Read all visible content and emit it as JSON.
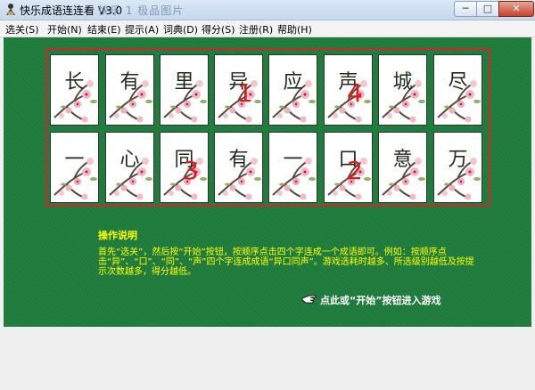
{
  "window": {
    "title": "快乐成语连连看 V3.0",
    "title_ghost": "快乐 1 极品图片",
    "minimize": "─",
    "maximize": "□",
    "close": "✕"
  },
  "menu": [
    {
      "label": "选关(S)"
    },
    {
      "label": "开始(N)"
    },
    {
      "label": "结束(E)"
    },
    {
      "label": "提示(A)"
    },
    {
      "label": "词典(D)"
    },
    {
      "label": "得分(S)"
    },
    {
      "label": "注册(R)"
    },
    {
      "label": "帮助(H)"
    }
  ],
  "cards_row1": [
    {
      "char": "长",
      "num": ""
    },
    {
      "char": "有",
      "num": ""
    },
    {
      "char": "里",
      "num": ""
    },
    {
      "char": "异",
      "num": "1"
    },
    {
      "char": "应",
      "num": ""
    },
    {
      "char": "声",
      "num": "4"
    },
    {
      "char": "城",
      "num": ""
    },
    {
      "char": "尽",
      "num": ""
    }
  ],
  "cards_row2": [
    {
      "char": "一",
      "num": ""
    },
    {
      "char": "心",
      "num": ""
    },
    {
      "char": "同",
      "num": "3"
    },
    {
      "char": "有",
      "num": ""
    },
    {
      "char": "一",
      "num": ""
    },
    {
      "char": "口",
      "num": "2"
    },
    {
      "char": "意",
      "num": ""
    },
    {
      "char": "万",
      "num": ""
    }
  ],
  "instructions": {
    "title": "操作说明",
    "text": "首先“选关”，然后按“开始”按钮，按顺序点击四个字连成一个成语即可。例如：按顺序点击“异”、“口”、“同”、“声”四个字连成成语“异口同声”。游戏选耗时越多、所选级别越低及按提示次数越多，得分越低。"
  },
  "start_hint": "点此或“开始”按钮进入游戏",
  "icons": {
    "app": "app-icon",
    "hand": "pointing-hand-icon",
    "blossom": "plum-blossom-icon"
  },
  "colors": {
    "board": "#1d7a3a",
    "frame": "#d3242a",
    "instruction": "#ffff00",
    "number": "#e01a1a"
  }
}
